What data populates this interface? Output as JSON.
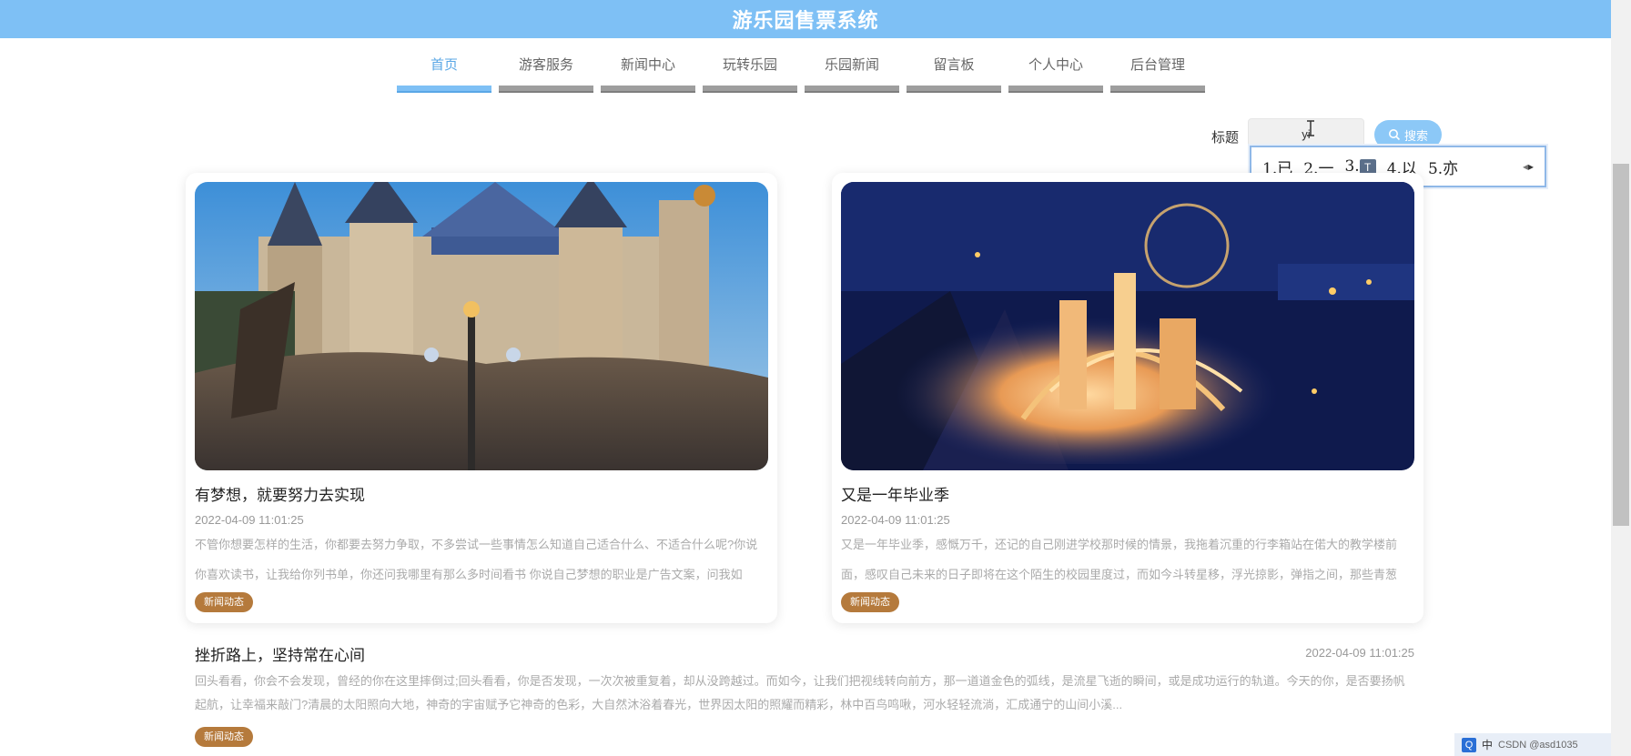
{
  "header": {
    "title": "游乐园售票系统"
  },
  "nav": {
    "items": [
      {
        "label": "首页"
      },
      {
        "label": "游客服务"
      },
      {
        "label": "新闻中心"
      },
      {
        "label": "玩转乐园"
      },
      {
        "label": "乐园新闻"
      },
      {
        "label": "留言板"
      },
      {
        "label": "个人中心"
      },
      {
        "label": "后台管理"
      }
    ]
  },
  "search": {
    "label": "标题",
    "value": "yi",
    "button_label": "搜索"
  },
  "ime": {
    "candidates": [
      "1.已",
      "2.一",
      "3.",
      "4.以",
      "5.亦"
    ]
  },
  "cards": [
    {
      "title": "有梦想，就要努力去实现",
      "date": "2022-04-09 11:01:25",
      "description": "不管你想要怎样的生活，你都要去努力争取，不多尝试一些事情怎么知道自己适合什么、不适合什么呢?你说你喜欢读书，让我给你列书单，你还问我哪里有那么多时间看书 你说自己梦想的职业是广告文案，问我如",
      "tag": "新闻动态"
    },
    {
      "title": "又是一年毕业季",
      "date": "2022-04-09 11:01:25",
      "description": "又是一年毕业季，感慨万千，还记的自己刚进学校那时候的情景，我拖着沉重的行李箱站在偌大的教学楼前面，感叹自己未来的日子即将在这个陌生的校园里度过，而如今斗转星移，浮光掠影，弹指之间，那些青葱",
      "tag": "新闻动态"
    }
  ],
  "list": [
    {
      "title": "挫折路上，坚持常在心间",
      "date": "2022-04-09 11:01:25",
      "description": "回头看看，你会不会发现，曾经的你在这里摔倒过;回头看看，你是否发现，一次次被重复着，却从没跨越过。而如今，让我们把视线转向前方，那一道道金色的弧线，是流星飞逝的瞬间，或是成功运行的轨道。今天的你，是否要扬帆起航，让幸福来敲门?清晨的太阳照向大地，神奇的宇宙赋予它神奇的色彩，大自然沐浴着春光，世界因太阳的照耀而精彩，林中百鸟鸣啾，河水轻轻流淌，汇成通宁的山间小溪...",
      "tag": "新闻动态"
    }
  ],
  "tray": {
    "ime_mode": "中",
    "watermark": "CSDN @asd1035"
  },
  "colors": {
    "header": "#7ec0f5",
    "tag": "#b57a3c",
    "active_nav": "#5aa7e6"
  }
}
